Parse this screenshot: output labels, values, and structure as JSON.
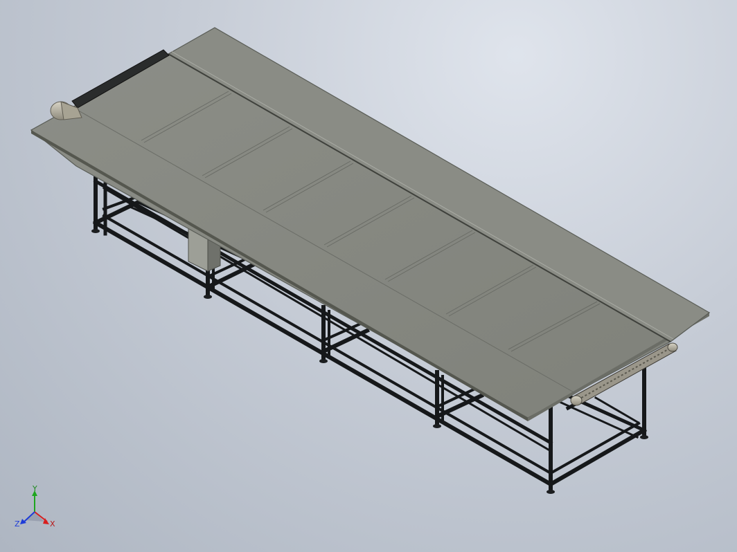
{
  "viewport": {
    "background_top": "#dfe4ec",
    "background_bottom": "#aeb6c2"
  },
  "model": {
    "name": "belt-conveyor",
    "belt_color": "#888a83",
    "belt_edge_color": "#5f625c",
    "frame_color": "#16181a",
    "roller_color": "#b8b3a2"
  },
  "triad": {
    "x_label": "X",
    "y_label": "Y",
    "z_label": "Z",
    "x_color": "#d81e1e",
    "y_color": "#1ea61e",
    "z_color": "#1e3cd8"
  }
}
